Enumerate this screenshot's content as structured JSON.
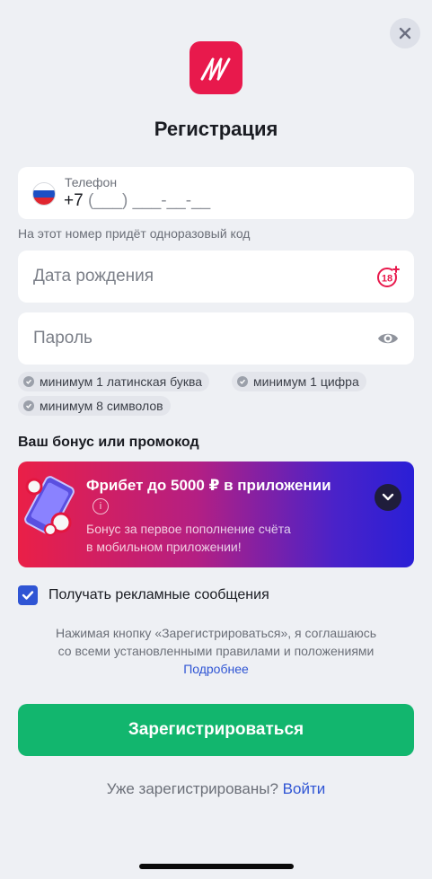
{
  "header": {
    "close_icon": "close-icon",
    "title": "Регистрация"
  },
  "phone": {
    "country_flag": "russia-flag-icon",
    "label": "Телефон",
    "prefix": "+7",
    "mask": "(___) ___-__-__",
    "hint": "На этот номер придёт одноразовый код"
  },
  "birth_date": {
    "placeholder": "Дата рождения",
    "icon": "age-18-plus-icon"
  },
  "password": {
    "placeholder": "Пароль",
    "icon": "eye-icon",
    "rules": [
      "минимум 1 латинская буква",
      "минимум 1 цифра",
      "минимум 8 символов"
    ]
  },
  "bonus": {
    "section_title": "Ваш бонус или промокод",
    "title": "Фрибет до 5000 ₽ в приложении",
    "description_line1": "Бонус за первое пополнение счёта",
    "description_line2": "в мобильном приложении!",
    "gradient_start": "#ea1f47",
    "gradient_end": "#2a1fd6"
  },
  "marketing": {
    "checked": true,
    "label": "Получать рекламные сообщения"
  },
  "terms": {
    "line1": "Нажимая кнопку «Зарегистрироваться», я соглашаюсь",
    "line2": "со всеми установленными правилами и положениями",
    "link": "Подробнее"
  },
  "register_button": "Зарегистрироваться",
  "login": {
    "question": "Уже зарегистрированы?",
    "link": "Войти"
  },
  "colors": {
    "brand": "#e8194c",
    "primary_button": "#12b66e",
    "link": "#2f55d4",
    "background": "#eef0f4"
  }
}
